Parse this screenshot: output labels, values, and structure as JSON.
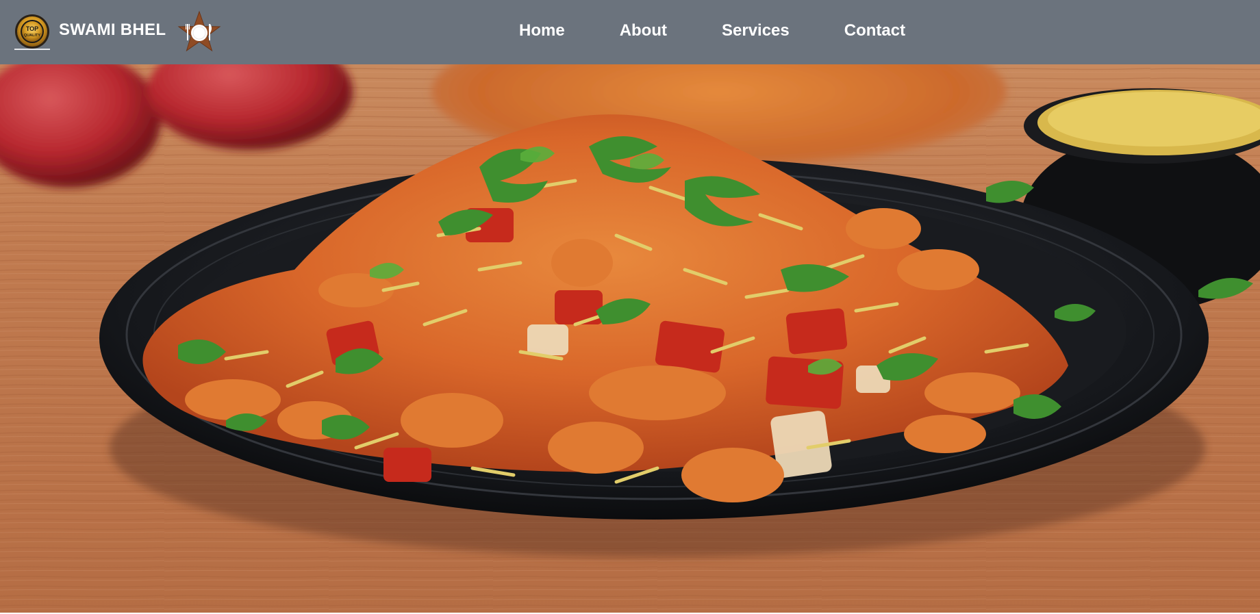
{
  "brand": {
    "name": "SWAMI BHEL",
    "badge_text_top": "TOP",
    "badge_text_bottom": "QUALITY",
    "badge_icon": "top-quality-badge-icon",
    "logo_icon": "star-plate-cutlery-icon"
  },
  "nav": {
    "items": [
      {
        "label": "Home"
      },
      {
        "label": "About"
      },
      {
        "label": "Services"
      },
      {
        "label": "Contact"
      }
    ]
  },
  "hero": {
    "image": "bhel-puri-plate-photo"
  },
  "colors": {
    "navbar": "#6b737d",
    "nav_text": "#ffffff",
    "plate": "#15171b",
    "table_wood": "#b9714a"
  }
}
